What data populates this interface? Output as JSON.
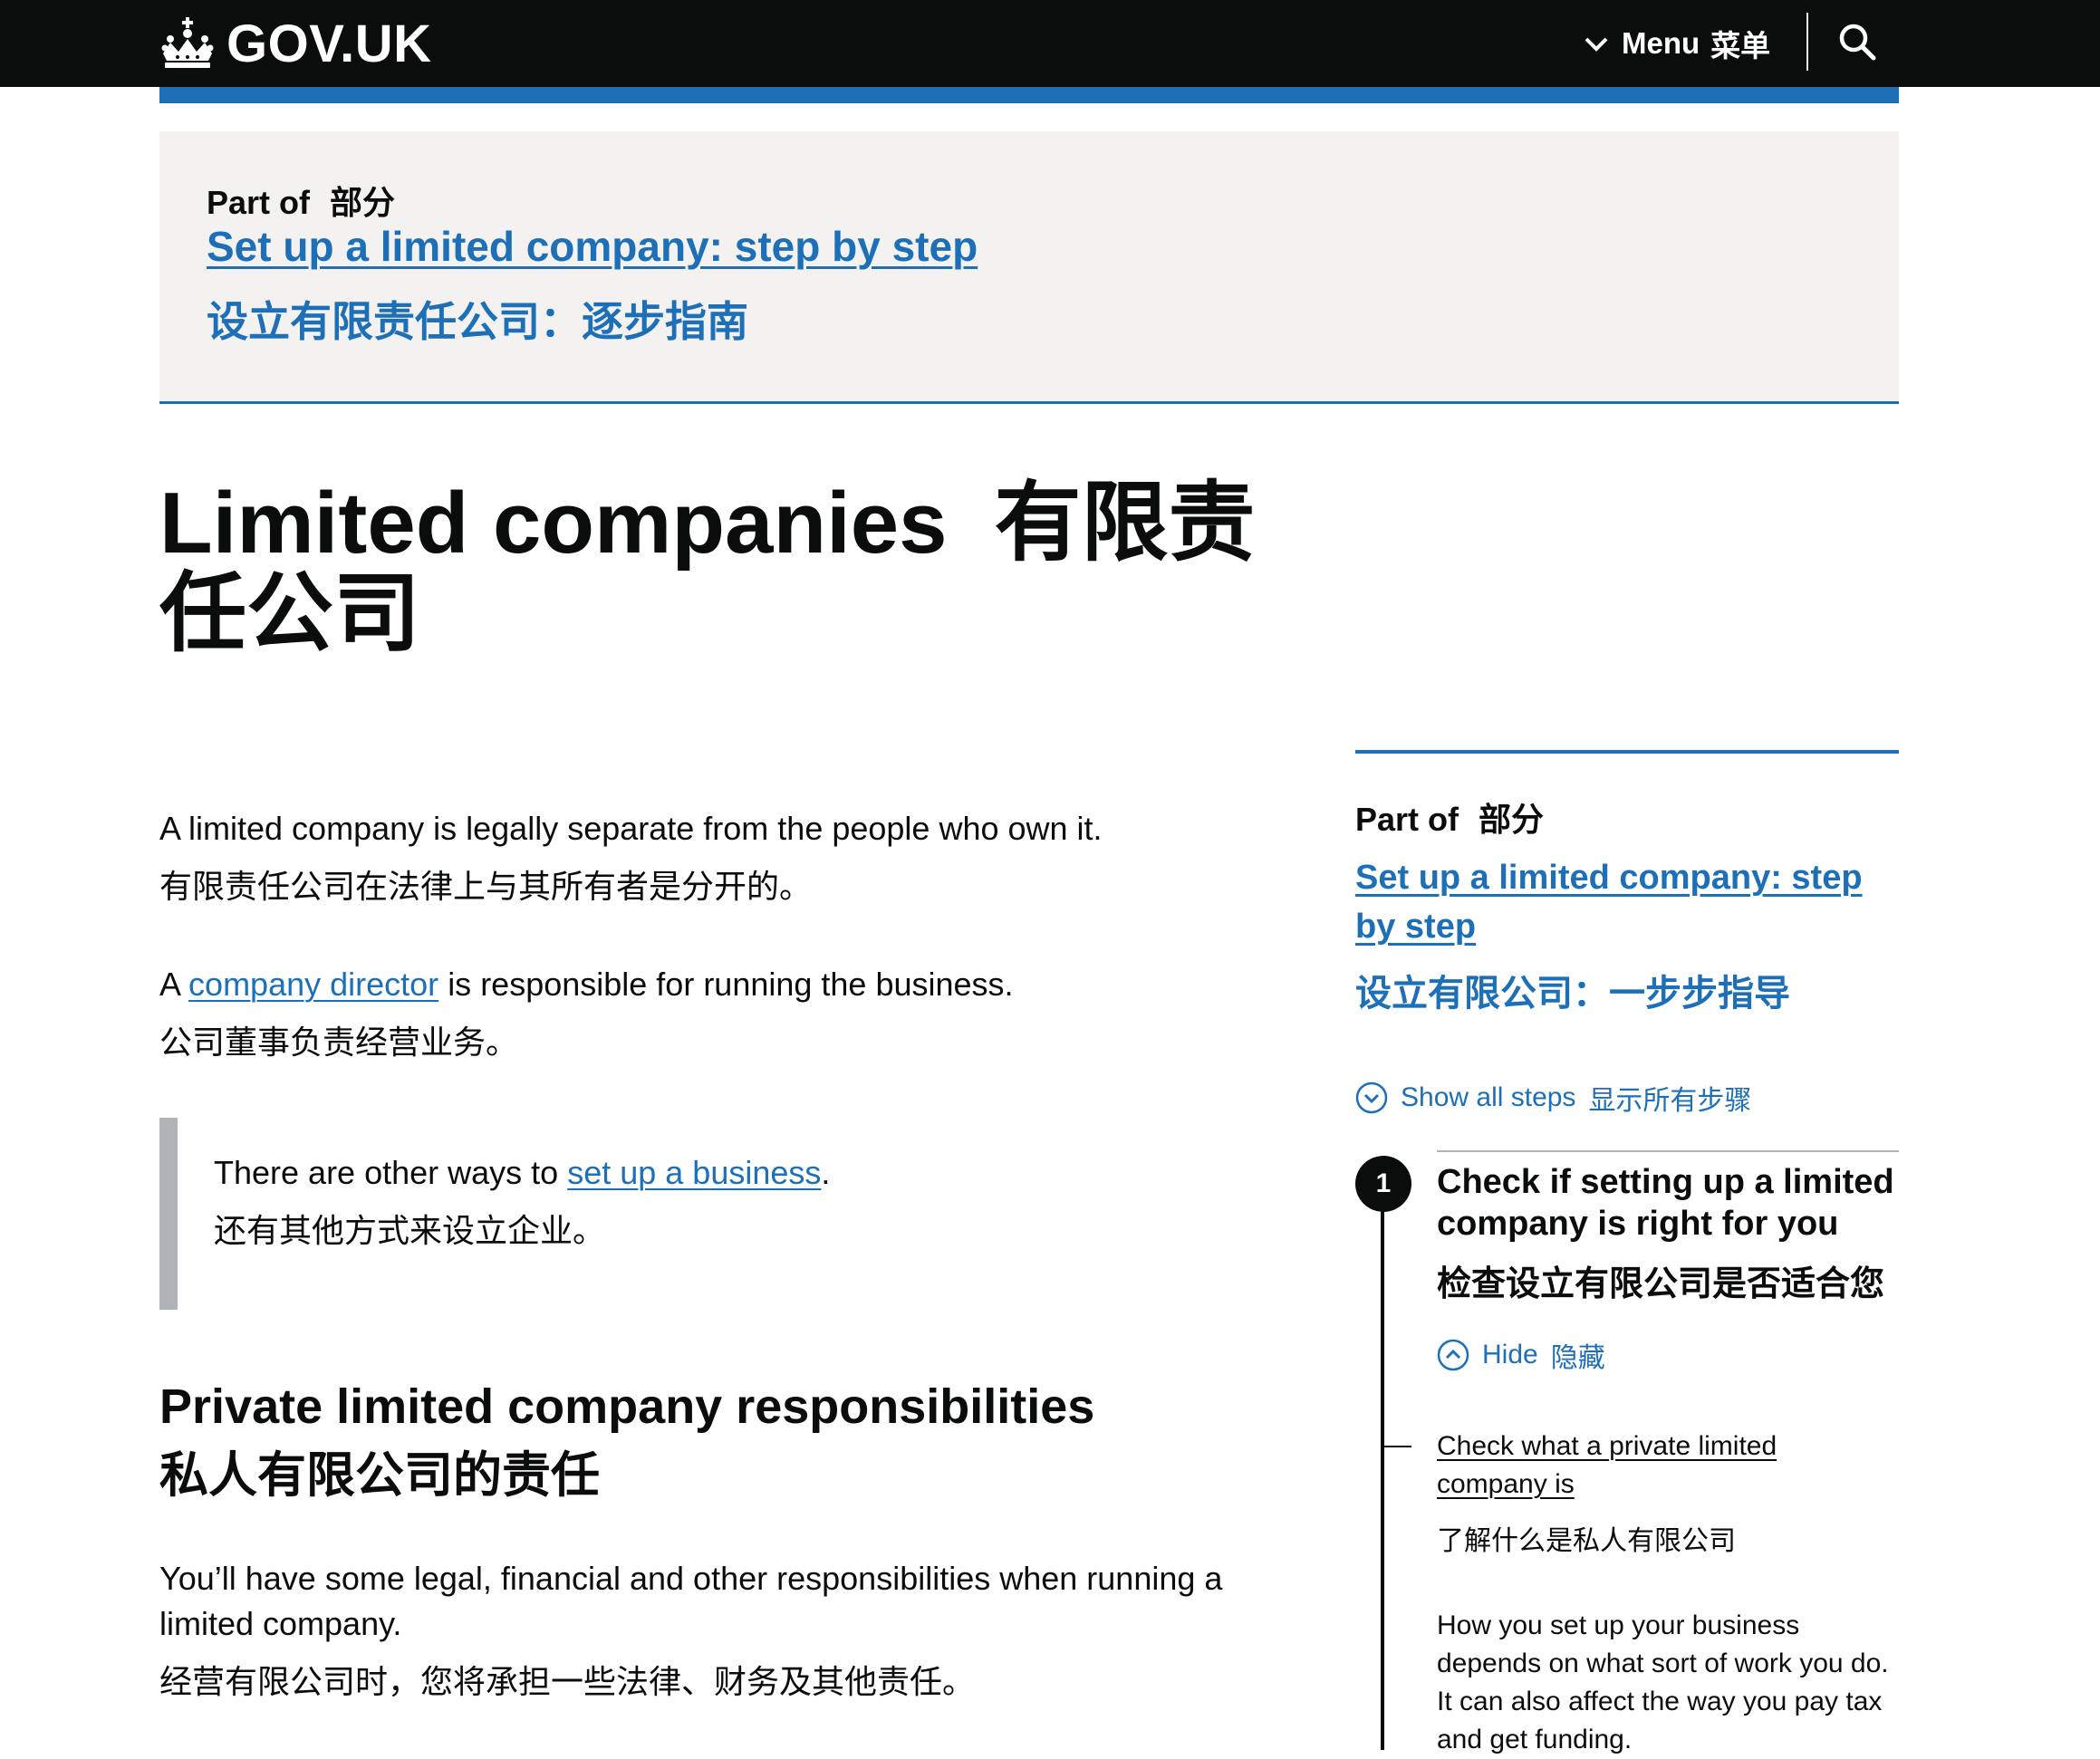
{
  "header": {
    "logo_text": "GOV.UK",
    "menu_label": "Menu",
    "menu_label_zh": "菜单",
    "search_icon": "search-icon"
  },
  "banner": {
    "part_of": "Part of",
    "part_of_zh": "部分",
    "link_en": "Set up a limited company: step by step",
    "link_zh": "设立有限责任公司：逐步指南"
  },
  "title": {
    "en": "Limited companies",
    "zh": "有限责任公司"
  },
  "main": {
    "p1_en": "A limited company is legally separate from the people who own it.",
    "p1_zh": "有限责任公司在法律上与其所有者是分开的。",
    "p2_prefix": "A",
    "p2_link": "company director",
    "p2_suffix": "is responsible for running the business.",
    "p2_zh": "公司董事负责经营业务。",
    "inset_prefix": "There are other ways to",
    "inset_link": "set up a business",
    "inset_suffix": ".",
    "inset_zh": "还有其他方式来设立企业。",
    "heading_en": "Private limited company responsibilities",
    "heading_zh": "私人有限公司的责任",
    "p3_en": "You’ll have some legal, financial and other responsibilities when running a limited company.",
    "p3_zh": "经营有限公司时，您将承担一些法律、财务及其他责任。"
  },
  "sidebar": {
    "part_of": "Part of",
    "part_of_zh": "部分",
    "link_en": "Set up a limited company: step by step",
    "link_zh": "设立有限公司：一步步指导",
    "show_all": "Show all steps",
    "show_all_zh": "显示所有步骤",
    "step": {
      "number": "1",
      "title_en": "Check if setting up a limited company is right for you",
      "title_zh": "检查设立有限公司是否适合您",
      "hide": "Hide",
      "hide_zh": "隐藏",
      "substep_link": "Check what a private limited company is",
      "substep_zh": "了解什么是私人有限公司",
      "body": "How you set up your business depends on what sort of work you do. It can also affect the way you pay tax and get funding."
    }
  },
  "colors": {
    "header_bg": "#0b0c0c",
    "link": "#1d70b8",
    "banner_bg": "#f3f2f1",
    "inset_border": "#b1b4b6"
  }
}
